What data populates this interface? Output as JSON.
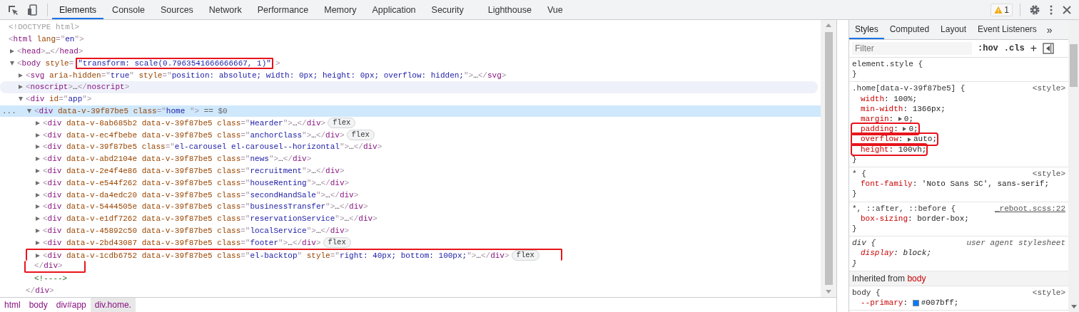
{
  "toolbar": {
    "tabs": [
      {
        "label": "Elements",
        "selected": true
      },
      {
        "label": "Console",
        "selected": false
      },
      {
        "label": "Sources",
        "selected": false
      },
      {
        "label": "Network",
        "selected": false
      },
      {
        "label": "Performance",
        "selected": false
      },
      {
        "label": "Memory",
        "selected": false
      },
      {
        "label": "Application",
        "selected": false
      },
      {
        "label": "Security",
        "selected": false
      },
      {
        "label": "Lighthouse",
        "selected": false
      },
      {
        "label": "Vue",
        "selected": false
      }
    ],
    "warning_count": "1"
  },
  "dom_tree": [
    {
      "tokens": [
        {
          "kind": "doctype",
          "text": "<!DOCTYPE html>"
        }
      ]
    },
    {
      "tokens": [
        {
          "kind": "punct",
          "text": "<"
        },
        {
          "kind": "tag",
          "text": "html"
        },
        {
          "kind": "attr",
          "text": " lang"
        },
        {
          "kind": "punct",
          "text": "=\""
        },
        {
          "kind": "value",
          "text": "en"
        },
        {
          "kind": "punct",
          "text": "\">"
        }
      ],
      "children": [
        {
          "kind": "node",
          "expanded": false,
          "tokens": [
            {
              "kind": "punct",
              "text": "<"
            },
            {
              "kind": "tag",
              "text": "head"
            },
            {
              "kind": "punct",
              "text": ">"
            },
            {
              "kind": "text",
              "text": "…"
            },
            {
              "kind": "punct",
              "text": "</"
            },
            {
              "kind": "tag",
              "text": "head"
            },
            {
              "kind": "punct",
              "text": ">"
            }
          ]
        },
        {
          "kind": "node",
          "expanded": true,
          "tokens": [
            {
              "kind": "punct",
              "text": "<"
            },
            {
              "kind": "tag",
              "text": "body"
            },
            {
              "kind": "attr",
              "text": " style"
            },
            {
              "kind": "punct",
              "text": "="
            },
            {
              "kind": "value",
              "text": "\"transform: scale(0.7963541666666667, 1)\"",
              "boxed": true
            },
            {
              "kind": "punct",
              "text": ">"
            }
          ],
          "children": [
            {
              "kind": "node",
              "expanded": false,
              "tokens": [
                {
                  "kind": "punct",
                  "text": "<"
                },
                {
                  "kind": "tag",
                  "text": "svg"
                },
                {
                  "kind": "attr",
                  "text": " aria-hidden"
                },
                {
                  "kind": "punct",
                  "text": "=\""
                },
                {
                  "kind": "value",
                  "text": "true"
                },
                {
                  "kind": "punct",
                  "text": "\""
                },
                {
                  "kind": "attr",
                  "text": " style"
                },
                {
                  "kind": "punct",
                  "text": "=\""
                },
                {
                  "kind": "value",
                  "text": "position: absolute; width: 0px; height: 0px; overflow: hidden;"
                },
                {
                  "kind": "punct",
                  "text": "\">"
                },
                {
                  "kind": "text",
                  "text": "…"
                },
                {
                  "kind": "punct",
                  "text": "</"
                },
                {
                  "kind": "tag",
                  "text": "svg"
                },
                {
                  "kind": "punct",
                  "text": ">"
                }
              ]
            },
            {
              "kind": "node",
              "expanded": false,
              "hovered": true,
              "tokens": [
                {
                  "kind": "punct",
                  "text": "<"
                },
                {
                  "kind": "tag",
                  "text": "noscript"
                },
                {
                  "kind": "punct",
                  "text": ">"
                },
                {
                  "kind": "text",
                  "text": "…"
                },
                {
                  "kind": "punct",
                  "text": "</"
                },
                {
                  "kind": "tag",
                  "text": "noscript"
                },
                {
                  "kind": "punct",
                  "text": ">"
                }
              ]
            },
            {
              "kind": "node",
              "expanded": true,
              "tokens": [
                {
                  "kind": "punct",
                  "text": "<"
                },
                {
                  "kind": "tag",
                  "text": "div"
                },
                {
                  "kind": "attr",
                  "text": " id"
                },
                {
                  "kind": "punct",
                  "text": "=\""
                },
                {
                  "kind": "value",
                  "text": "app"
                },
                {
                  "kind": "punct",
                  "text": "\">"
                }
              ],
              "closing": {
                "tokens": [
                  {
                    "kind": "punct",
                    "text": "</"
                  },
                  {
                    "kind": "tag",
                    "text": "div"
                  },
                  {
                    "kind": "punct",
                    "text": ">"
                  }
                ]
              },
              "children": [
                {
                  "kind": "node",
                  "expanded": true,
                  "selected": true,
                  "marker": "...",
                  "suffix": " == $0",
                  "tokens": [
                    {
                      "kind": "punct",
                      "text": "<"
                    },
                    {
                      "kind": "tag",
                      "text": "div"
                    },
                    {
                      "kind": "attr",
                      "text": " data-v-39f87be5"
                    },
                    {
                      "kind": "attr",
                      "text": " class"
                    },
                    {
                      "kind": "punct",
                      "text": "=\""
                    },
                    {
                      "kind": "value",
                      "text": "home "
                    },
                    {
                      "kind": "punct",
                      "text": "\">"
                    }
                  ],
                  "closing": {
                    "boxed": true,
                    "tokens": [
                      {
                        "kind": "punct",
                        "text": "</"
                      },
                      {
                        "kind": "tag",
                        "text": "div"
                      },
                      {
                        "kind": "punct",
                        "text": ">"
                      }
                    ]
                  },
                  "children": [
                    {
                      "kind": "node",
                      "expanded": false,
                      "badge": "flex",
                      "tokens": [
                        {
                          "kind": "punct",
                          "text": "<"
                        },
                        {
                          "kind": "tag",
                          "text": "div"
                        },
                        {
                          "kind": "attr",
                          "text": " data-v-8ab685b2 data-v-39f87be5 class"
                        },
                        {
                          "kind": "punct",
                          "text": "=\""
                        },
                        {
                          "kind": "value",
                          "text": "Hearder"
                        },
                        {
                          "kind": "punct",
                          "text": "\">"
                        },
                        {
                          "kind": "text",
                          "text": "…"
                        },
                        {
                          "kind": "punct",
                          "text": "</"
                        },
                        {
                          "kind": "tag",
                          "text": "div"
                        },
                        {
                          "kind": "punct",
                          "text": ">"
                        }
                      ]
                    },
                    {
                      "kind": "node",
                      "expanded": false,
                      "badge": "flex",
                      "tokens": [
                        {
                          "kind": "punct",
                          "text": "<"
                        },
                        {
                          "kind": "tag",
                          "text": "div"
                        },
                        {
                          "kind": "attr",
                          "text": " data-v-ec4fbebe data-v-39f87be5 class"
                        },
                        {
                          "kind": "punct",
                          "text": "=\""
                        },
                        {
                          "kind": "value",
                          "text": "anchorClass"
                        },
                        {
                          "kind": "punct",
                          "text": "\">"
                        },
                        {
                          "kind": "text",
                          "text": "…"
                        },
                        {
                          "kind": "punct",
                          "text": "</"
                        },
                        {
                          "kind": "tag",
                          "text": "div"
                        },
                        {
                          "kind": "punct",
                          "text": ">"
                        }
                      ]
                    },
                    {
                      "kind": "node",
                      "expanded": false,
                      "tokens": [
                        {
                          "kind": "punct",
                          "text": "<"
                        },
                        {
                          "kind": "tag",
                          "text": "div"
                        },
                        {
                          "kind": "attr",
                          "text": " data-v-39f87be5 class"
                        },
                        {
                          "kind": "punct",
                          "text": "=\""
                        },
                        {
                          "kind": "value",
                          "text": "el-carousel el-carousel--horizontal"
                        },
                        {
                          "kind": "punct",
                          "text": "\">"
                        },
                        {
                          "kind": "text",
                          "text": "…"
                        },
                        {
                          "kind": "punct",
                          "text": "</"
                        },
                        {
                          "kind": "tag",
                          "text": "div"
                        },
                        {
                          "kind": "punct",
                          "text": ">"
                        }
                      ]
                    },
                    {
                      "kind": "node",
                      "expanded": false,
                      "tokens": [
                        {
                          "kind": "punct",
                          "text": "<"
                        },
                        {
                          "kind": "tag",
                          "text": "div"
                        },
                        {
                          "kind": "attr",
                          "text": " data-v-abd2104e data-v-39f87be5 class"
                        },
                        {
                          "kind": "punct",
                          "text": "=\""
                        },
                        {
                          "kind": "value",
                          "text": "news"
                        },
                        {
                          "kind": "punct",
                          "text": "\">"
                        },
                        {
                          "kind": "text",
                          "text": "…"
                        },
                        {
                          "kind": "punct",
                          "text": "</"
                        },
                        {
                          "kind": "tag",
                          "text": "div"
                        },
                        {
                          "kind": "punct",
                          "text": ">"
                        }
                      ]
                    },
                    {
                      "kind": "node",
                      "expanded": false,
                      "tokens": [
                        {
                          "kind": "punct",
                          "text": "<"
                        },
                        {
                          "kind": "tag",
                          "text": "div"
                        },
                        {
                          "kind": "attr",
                          "text": " data-v-2e4f4e86 data-v-39f87be5 class"
                        },
                        {
                          "kind": "punct",
                          "text": "=\""
                        },
                        {
                          "kind": "value",
                          "text": "recruitment"
                        },
                        {
                          "kind": "punct",
                          "text": "\">"
                        },
                        {
                          "kind": "text",
                          "text": "…"
                        },
                        {
                          "kind": "punct",
                          "text": "</"
                        },
                        {
                          "kind": "tag",
                          "text": "div"
                        },
                        {
                          "kind": "punct",
                          "text": ">"
                        }
                      ]
                    },
                    {
                      "kind": "node",
                      "expanded": false,
                      "tokens": [
                        {
                          "kind": "punct",
                          "text": "<"
                        },
                        {
                          "kind": "tag",
                          "text": "div"
                        },
                        {
                          "kind": "attr",
                          "text": " data-v-e544f262 data-v-39f87be5 class"
                        },
                        {
                          "kind": "punct",
                          "text": "=\""
                        },
                        {
                          "kind": "value",
                          "text": "houseRenting"
                        },
                        {
                          "kind": "punct",
                          "text": "\">"
                        },
                        {
                          "kind": "text",
                          "text": "…"
                        },
                        {
                          "kind": "punct",
                          "text": "</"
                        },
                        {
                          "kind": "tag",
                          "text": "div"
                        },
                        {
                          "kind": "punct",
                          "text": ">"
                        }
                      ]
                    },
                    {
                      "kind": "node",
                      "expanded": false,
                      "tokens": [
                        {
                          "kind": "punct",
                          "text": "<"
                        },
                        {
                          "kind": "tag",
                          "text": "div"
                        },
                        {
                          "kind": "attr",
                          "text": " data-v-da4edc20 data-v-39f87be5 class"
                        },
                        {
                          "kind": "punct",
                          "text": "=\""
                        },
                        {
                          "kind": "value",
                          "text": "secondHandSale"
                        },
                        {
                          "kind": "punct",
                          "text": "\">"
                        },
                        {
                          "kind": "text",
                          "text": "…"
                        },
                        {
                          "kind": "punct",
                          "text": "</"
                        },
                        {
                          "kind": "tag",
                          "text": "div"
                        },
                        {
                          "kind": "punct",
                          "text": ">"
                        }
                      ]
                    },
                    {
                      "kind": "node",
                      "expanded": false,
                      "tokens": [
                        {
                          "kind": "punct",
                          "text": "<"
                        },
                        {
                          "kind": "tag",
                          "text": "div"
                        },
                        {
                          "kind": "attr",
                          "text": " data-v-5444505e data-v-39f87be5 class"
                        },
                        {
                          "kind": "punct",
                          "text": "=\""
                        },
                        {
                          "kind": "value",
                          "text": "businessTransfer"
                        },
                        {
                          "kind": "punct",
                          "text": "\">"
                        },
                        {
                          "kind": "text",
                          "text": "…"
                        },
                        {
                          "kind": "punct",
                          "text": "</"
                        },
                        {
                          "kind": "tag",
                          "text": "div"
                        },
                        {
                          "kind": "punct",
                          "text": ">"
                        }
                      ]
                    },
                    {
                      "kind": "node",
                      "expanded": false,
                      "tokens": [
                        {
                          "kind": "punct",
                          "text": "<"
                        },
                        {
                          "kind": "tag",
                          "text": "div"
                        },
                        {
                          "kind": "attr",
                          "text": " data-v-e1df7262 data-v-39f87be5 class"
                        },
                        {
                          "kind": "punct",
                          "text": "=\""
                        },
                        {
                          "kind": "value",
                          "text": "reservationService"
                        },
                        {
                          "kind": "punct",
                          "text": "\">"
                        },
                        {
                          "kind": "text",
                          "text": "…"
                        },
                        {
                          "kind": "punct",
                          "text": "</"
                        },
                        {
                          "kind": "tag",
                          "text": "div"
                        },
                        {
                          "kind": "punct",
                          "text": ">"
                        }
                      ]
                    },
                    {
                      "kind": "node",
                      "expanded": false,
                      "tokens": [
                        {
                          "kind": "punct",
                          "text": "<"
                        },
                        {
                          "kind": "tag",
                          "text": "div"
                        },
                        {
                          "kind": "attr",
                          "text": " data-v-45892c50 data-v-39f87be5 class"
                        },
                        {
                          "kind": "punct",
                          "text": "=\""
                        },
                        {
                          "kind": "value",
                          "text": "localService"
                        },
                        {
                          "kind": "punct",
                          "text": "\">"
                        },
                        {
                          "kind": "text",
                          "text": "…"
                        },
                        {
                          "kind": "punct",
                          "text": "</"
                        },
                        {
                          "kind": "tag",
                          "text": "div"
                        },
                        {
                          "kind": "punct",
                          "text": ">"
                        }
                      ]
                    },
                    {
                      "kind": "node",
                      "expanded": false,
                      "badge": "flex",
                      "tokens": [
                        {
                          "kind": "punct",
                          "text": "<"
                        },
                        {
                          "kind": "tag",
                          "text": "div"
                        },
                        {
                          "kind": "attr",
                          "text": " data-v-2bd43087 data-v-39f87be5 class"
                        },
                        {
                          "kind": "punct",
                          "text": "=\""
                        },
                        {
                          "kind": "value",
                          "text": "footer"
                        },
                        {
                          "kind": "punct",
                          "text": "\">"
                        },
                        {
                          "kind": "text",
                          "text": "…"
                        },
                        {
                          "kind": "punct",
                          "text": "</"
                        },
                        {
                          "kind": "tag",
                          "text": "div"
                        },
                        {
                          "kind": "punct",
                          "text": ">"
                        }
                      ]
                    },
                    {
                      "kind": "node",
                      "expanded": false,
                      "badge": "flex",
                      "boxed": true,
                      "tokens": [
                        {
                          "kind": "punct",
                          "text": "<"
                        },
                        {
                          "kind": "tag",
                          "text": "div"
                        },
                        {
                          "kind": "attr",
                          "text": " data-v-1cdb6752 data-v-39f87be5 class"
                        },
                        {
                          "kind": "punct",
                          "text": "=\""
                        },
                        {
                          "kind": "value",
                          "text": "el-backtop"
                        },
                        {
                          "kind": "punct",
                          "text": "\""
                        },
                        {
                          "kind": "attr",
                          "text": " style"
                        },
                        {
                          "kind": "punct",
                          "text": "=\""
                        },
                        {
                          "kind": "value",
                          "text": "right: 40px; bottom: 100px;"
                        },
                        {
                          "kind": "punct",
                          "text": "\">"
                        },
                        {
                          "kind": "text",
                          "text": "…"
                        },
                        {
                          "kind": "punct",
                          "text": "</"
                        },
                        {
                          "kind": "tag",
                          "text": "div"
                        },
                        {
                          "kind": "punct",
                          "text": ">"
                        }
                      ]
                    }
                  ]
                },
                {
                  "tokens": [
                    {
                      "kind": "comment",
                      "text": "<!---->"
                    }
                  ]
                }
              ]
            }
          ]
        }
      ]
    }
  ],
  "breadcrumbs": [
    {
      "label": "html",
      "selected": false
    },
    {
      "label": "body",
      "selected": false
    },
    {
      "label": "div#app",
      "selected": false
    },
    {
      "label": "div.home.",
      "selected": true
    }
  ],
  "sidebar": {
    "tabs": [
      {
        "label": "Styles",
        "selected": true
      },
      {
        "label": "Computed",
        "selected": false
      },
      {
        "label": "Layout",
        "selected": false
      },
      {
        "label": "Event Listeners",
        "selected": false
      }
    ],
    "more": "»",
    "filter": {
      "placeholder": "Filter"
    },
    "hov": ":hov",
    "cls": ".cls",
    "add": "+",
    "rules": [
      {
        "kind": "rule",
        "italic": false,
        "selector": "element.style {",
        "close": "}"
      },
      {
        "kind": "rule",
        "italic": false,
        "selector": ".home[data-v-39f87be5] {",
        "source": "<style>",
        "underlined": false,
        "close": "}",
        "properties": [
          {
            "name": "width",
            "separator": ": ",
            "value": "100%;",
            "expandable": false,
            "boxed": false
          },
          {
            "name": "min-width",
            "separator": ": ",
            "value": "1366px;",
            "expandable": false,
            "boxed": false
          },
          {
            "name": "margin",
            "separator": ": ",
            "value": "0;",
            "expandable": true,
            "boxed": false
          },
          {
            "name": "padding",
            "separator": ": ",
            "value": "0;",
            "expandable": true,
            "boxed": true
          },
          {
            "name": "overflow",
            "separator": ": ",
            "value": "auto;",
            "expandable": true,
            "boxed": true
          },
          {
            "name": "height",
            "separator": ": ",
            "value": "100vh;",
            "expandable": false,
            "boxed": true
          }
        ]
      },
      {
        "kind": "rule",
        "italic": false,
        "selector": "* {",
        "source": "<style>",
        "underlined": false,
        "close": "}",
        "properties": [
          {
            "name": "font-family",
            "separator": ": ",
            "value": "'Noto Sans SC', sans-serif;",
            "expandable": false,
            "boxed": false
          }
        ]
      },
      {
        "kind": "rule",
        "italic": false,
        "selector": "*, ::after, ::before {",
        "source": "_reboot.scss:22",
        "underlined": true,
        "close": "}",
        "properties": [
          {
            "name": "box-sizing",
            "separator": ": ",
            "value": "border-box;",
            "expandable": false,
            "boxed": false
          }
        ]
      },
      {
        "kind": "rule",
        "italic": true,
        "selector": "div {",
        "source": "user agent stylesheet",
        "underlined": false,
        "close": "}",
        "properties": [
          {
            "name": "display",
            "separator": ": ",
            "value": "block;",
            "expandable": false,
            "boxed": false
          }
        ]
      },
      {
        "kind": "inherited",
        "label": "Inherited from",
        "element": "body"
      },
      {
        "kind": "rule",
        "italic": false,
        "selector": "body {",
        "source": "<style>",
        "underlined": false,
        "properties": [
          {
            "name": "--primary",
            "separator": ": ",
            "value": "#007bff;",
            "expandable": false,
            "boxed": false,
            "color": "#007bff"
          }
        ]
      }
    ]
  }
}
